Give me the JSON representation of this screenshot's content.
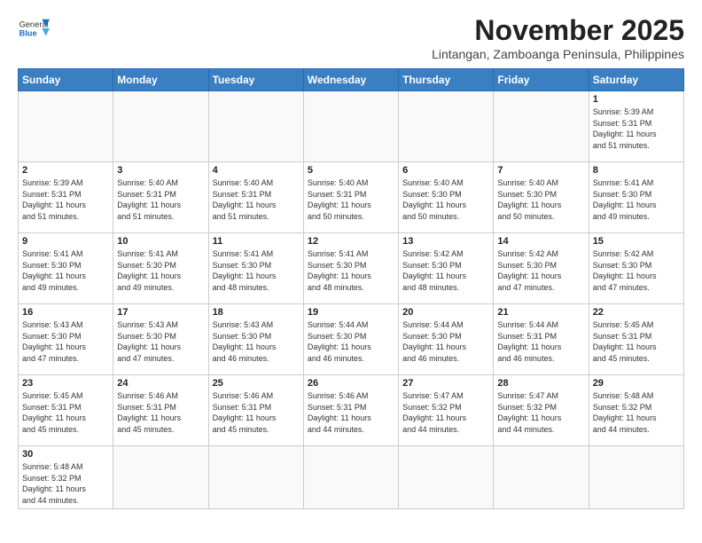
{
  "header": {
    "logo_general": "General",
    "logo_blue": "Blue",
    "title": "November 2025",
    "subtitle": "Lintangan, Zamboanga Peninsula, Philippines"
  },
  "weekdays": [
    "Sunday",
    "Monday",
    "Tuesday",
    "Wednesday",
    "Thursday",
    "Friday",
    "Saturday"
  ],
  "weeks": [
    [
      {
        "day": "",
        "info": ""
      },
      {
        "day": "",
        "info": ""
      },
      {
        "day": "",
        "info": ""
      },
      {
        "day": "",
        "info": ""
      },
      {
        "day": "",
        "info": ""
      },
      {
        "day": "",
        "info": ""
      },
      {
        "day": "1",
        "info": "Sunrise: 5:39 AM\nSunset: 5:31 PM\nDaylight: 11 hours\nand 51 minutes."
      }
    ],
    [
      {
        "day": "2",
        "info": "Sunrise: 5:39 AM\nSunset: 5:31 PM\nDaylight: 11 hours\nand 51 minutes."
      },
      {
        "day": "3",
        "info": "Sunrise: 5:40 AM\nSunset: 5:31 PM\nDaylight: 11 hours\nand 51 minutes."
      },
      {
        "day": "4",
        "info": "Sunrise: 5:40 AM\nSunset: 5:31 PM\nDaylight: 11 hours\nand 51 minutes."
      },
      {
        "day": "5",
        "info": "Sunrise: 5:40 AM\nSunset: 5:31 PM\nDaylight: 11 hours\nand 50 minutes."
      },
      {
        "day": "6",
        "info": "Sunrise: 5:40 AM\nSunset: 5:30 PM\nDaylight: 11 hours\nand 50 minutes."
      },
      {
        "day": "7",
        "info": "Sunrise: 5:40 AM\nSunset: 5:30 PM\nDaylight: 11 hours\nand 50 minutes."
      },
      {
        "day": "8",
        "info": "Sunrise: 5:41 AM\nSunset: 5:30 PM\nDaylight: 11 hours\nand 49 minutes."
      }
    ],
    [
      {
        "day": "9",
        "info": "Sunrise: 5:41 AM\nSunset: 5:30 PM\nDaylight: 11 hours\nand 49 minutes."
      },
      {
        "day": "10",
        "info": "Sunrise: 5:41 AM\nSunset: 5:30 PM\nDaylight: 11 hours\nand 49 minutes."
      },
      {
        "day": "11",
        "info": "Sunrise: 5:41 AM\nSunset: 5:30 PM\nDaylight: 11 hours\nand 48 minutes."
      },
      {
        "day": "12",
        "info": "Sunrise: 5:41 AM\nSunset: 5:30 PM\nDaylight: 11 hours\nand 48 minutes."
      },
      {
        "day": "13",
        "info": "Sunrise: 5:42 AM\nSunset: 5:30 PM\nDaylight: 11 hours\nand 48 minutes."
      },
      {
        "day": "14",
        "info": "Sunrise: 5:42 AM\nSunset: 5:30 PM\nDaylight: 11 hours\nand 47 minutes."
      },
      {
        "day": "15",
        "info": "Sunrise: 5:42 AM\nSunset: 5:30 PM\nDaylight: 11 hours\nand 47 minutes."
      }
    ],
    [
      {
        "day": "16",
        "info": "Sunrise: 5:43 AM\nSunset: 5:30 PM\nDaylight: 11 hours\nand 47 minutes."
      },
      {
        "day": "17",
        "info": "Sunrise: 5:43 AM\nSunset: 5:30 PM\nDaylight: 11 hours\nand 47 minutes."
      },
      {
        "day": "18",
        "info": "Sunrise: 5:43 AM\nSunset: 5:30 PM\nDaylight: 11 hours\nand 46 minutes."
      },
      {
        "day": "19",
        "info": "Sunrise: 5:44 AM\nSunset: 5:30 PM\nDaylight: 11 hours\nand 46 minutes."
      },
      {
        "day": "20",
        "info": "Sunrise: 5:44 AM\nSunset: 5:30 PM\nDaylight: 11 hours\nand 46 minutes."
      },
      {
        "day": "21",
        "info": "Sunrise: 5:44 AM\nSunset: 5:31 PM\nDaylight: 11 hours\nand 46 minutes."
      },
      {
        "day": "22",
        "info": "Sunrise: 5:45 AM\nSunset: 5:31 PM\nDaylight: 11 hours\nand 45 minutes."
      }
    ],
    [
      {
        "day": "23",
        "info": "Sunrise: 5:45 AM\nSunset: 5:31 PM\nDaylight: 11 hours\nand 45 minutes."
      },
      {
        "day": "24",
        "info": "Sunrise: 5:46 AM\nSunset: 5:31 PM\nDaylight: 11 hours\nand 45 minutes."
      },
      {
        "day": "25",
        "info": "Sunrise: 5:46 AM\nSunset: 5:31 PM\nDaylight: 11 hours\nand 45 minutes."
      },
      {
        "day": "26",
        "info": "Sunrise: 5:46 AM\nSunset: 5:31 PM\nDaylight: 11 hours\nand 44 minutes."
      },
      {
        "day": "27",
        "info": "Sunrise: 5:47 AM\nSunset: 5:32 PM\nDaylight: 11 hours\nand 44 minutes."
      },
      {
        "day": "28",
        "info": "Sunrise: 5:47 AM\nSunset: 5:32 PM\nDaylight: 11 hours\nand 44 minutes."
      },
      {
        "day": "29",
        "info": "Sunrise: 5:48 AM\nSunset: 5:32 PM\nDaylight: 11 hours\nand 44 minutes."
      }
    ],
    [
      {
        "day": "30",
        "info": "Sunrise: 5:48 AM\nSunset: 5:32 PM\nDaylight: 11 hours\nand 44 minutes."
      },
      {
        "day": "",
        "info": ""
      },
      {
        "day": "",
        "info": ""
      },
      {
        "day": "",
        "info": ""
      },
      {
        "day": "",
        "info": ""
      },
      {
        "day": "",
        "info": ""
      },
      {
        "day": "",
        "info": ""
      }
    ]
  ]
}
